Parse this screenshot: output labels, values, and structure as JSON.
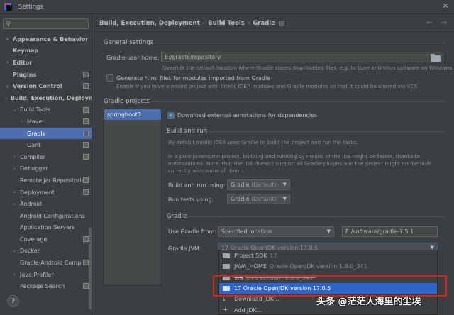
{
  "window": {
    "title": "Settings",
    "close_glyph": "×"
  },
  "search": {
    "placeholder": ""
  },
  "sidebar": {
    "items": [
      {
        "label": "Appearance & Behavior",
        "arrow": "›",
        "bold": true,
        "depth": 0
      },
      {
        "label": "Keymap",
        "arrow": "",
        "bold": true,
        "depth": 0
      },
      {
        "label": "Editor",
        "arrow": "›",
        "bold": true,
        "depth": 0
      },
      {
        "label": "Plugins",
        "arrow": "",
        "bold": true,
        "depth": 0,
        "proj": true
      },
      {
        "label": "Version Control",
        "arrow": "›",
        "bold": true,
        "depth": 0,
        "proj": true
      },
      {
        "label": "Build, Execution, Deployment",
        "arrow": "⌄",
        "bold": true,
        "depth": 0
      },
      {
        "label": "Build Tools",
        "arrow": "⌄",
        "bold": false,
        "depth": 1,
        "proj": true
      },
      {
        "label": "Maven",
        "arrow": "›",
        "bold": false,
        "depth": 2,
        "proj": true
      },
      {
        "label": "Gradle",
        "arrow": "",
        "bold": false,
        "depth": 2,
        "proj": true,
        "selected": true
      },
      {
        "label": "Gant",
        "arrow": "",
        "bold": false,
        "depth": 2,
        "proj": true
      },
      {
        "label": "Compiler",
        "arrow": "›",
        "bold": false,
        "depth": 1,
        "proj": true
      },
      {
        "label": "Debugger",
        "arrow": "›",
        "bold": false,
        "depth": 1
      },
      {
        "label": "Remote Jar Repositories",
        "arrow": "",
        "bold": false,
        "depth": 1,
        "proj": true
      },
      {
        "label": "Deployment",
        "arrow": "›",
        "bold": false,
        "depth": 1,
        "proj": true
      },
      {
        "label": "Android",
        "arrow": "›",
        "bold": false,
        "depth": 1
      },
      {
        "label": "Android Configurations",
        "arrow": "",
        "bold": false,
        "depth": 1
      },
      {
        "label": "Application Servers",
        "arrow": "",
        "bold": false,
        "depth": 1
      },
      {
        "label": "Coverage",
        "arrow": "",
        "bold": false,
        "depth": 1,
        "proj": true
      },
      {
        "label": "Docker",
        "arrow": "›",
        "bold": false,
        "depth": 1
      },
      {
        "label": "Gradle-Android Compiler",
        "arrow": "",
        "bold": false,
        "depth": 1,
        "proj": true
      },
      {
        "label": "Java Profiler",
        "arrow": "›",
        "bold": false,
        "depth": 1
      },
      {
        "label": "Package Search",
        "arrow": "",
        "bold": false,
        "depth": 1,
        "proj": true
      }
    ]
  },
  "help": {
    "label": "?"
  },
  "breadcrumb": {
    "parts": [
      "Build, Execution, Deployment",
      "Build Tools",
      "Gradle"
    ],
    "sep": "›"
  },
  "nav": {
    "back": "←",
    "forward": "→"
  },
  "general": {
    "title": "General settings",
    "user_home_label": "Gradle user home:",
    "user_home_value": "E:/gradle/repository",
    "user_home_hint": "Override the default location where Gradle stores downloaded files, e.g. to tune anti-virus software on Windows",
    "iml_label": "Generate *.iml files for modules imported from Gradle",
    "iml_hint": "Enable if you have a mixed project with IntelliJ IDEA modules and Gradle modules so that it could be shared via VCS"
  },
  "projects": {
    "title": "Gradle projects",
    "list": [
      "springboot3"
    ],
    "download_annotations": "Download external annotations for dependencies"
  },
  "build_and_run": {
    "title": "Build and run",
    "hint1": "By default IntelliJ IDEA uses Gradle to build the project and run the tasks.",
    "hint2a": "In a pure Java/Kotlin project, building and running by means of the IDE might be faster, thanks to",
    "hint2b": "optimizations. Note, that the IDE doesn't support all Gradle plugins and the project might not be built",
    "hint2c": "correctly with some of them.",
    "build_label": "Build and run using:",
    "build_value": "Gradle",
    "build_value_suffix": "(Default)",
    "tests_label": "Run tests using:",
    "tests_value": "Gradle",
    "tests_value_suffix": "(Default)"
  },
  "gradle": {
    "title": "Gradle",
    "use_from_label": "Use Gradle from:",
    "use_from_value": "Specified location",
    "location_value": "E:/software/gradle-7.5.1",
    "jvm_label": "Gradle JVM:",
    "jvm_value": "17 Oracle OpenJDK version 17.0.5"
  },
  "jvm_dropdown": {
    "items": [
      {
        "name": "Project SDK",
        "sub": "17",
        "icon": "folder"
      },
      {
        "name": "JAVA_HOME",
        "sub": "Oracle OpenJDK version 1.8.0_341",
        "icon": "folder"
      },
      {
        "name": "1.8",
        "sub": "java version \"1.8.0_341\"",
        "icon": "folder",
        "strike": true
      },
      {
        "name": "17 Oracle OpenJDK version 17.0.5",
        "sub": "",
        "icon": "folder",
        "selected": true
      },
      {
        "name": "Download JDK...",
        "sub": "",
        "icon": "download"
      },
      {
        "name": "Add JDK...",
        "sub": "",
        "icon": "plus"
      }
    ]
  },
  "watermark": {
    "text": "头条 @茫茫人海里的尘埃"
  },
  "colors": {
    "selection": "#4b6eaf",
    "dropdown_selection": "#2f65ca",
    "highlight": "#e01f1f"
  }
}
